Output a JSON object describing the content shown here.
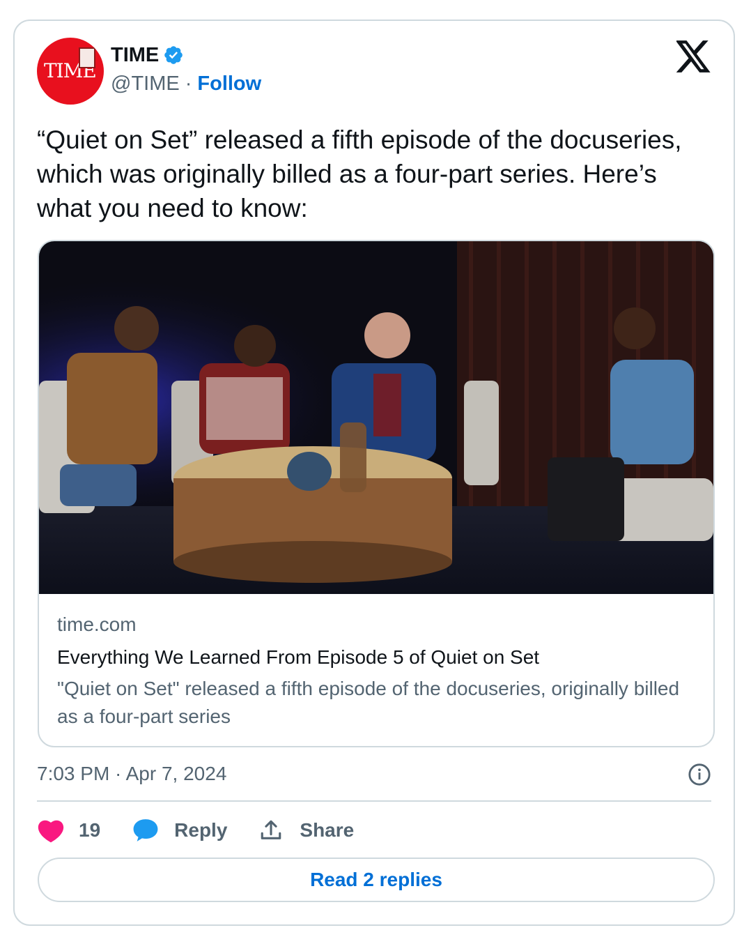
{
  "author": {
    "name": "TIME",
    "handle": "@TIME",
    "separator": "·",
    "follow_label": "Follow",
    "avatar_text": "TIME",
    "verified": true
  },
  "tweet": {
    "text": "“Quiet on Set” released a fifth episode of the docuseries, which was originally billed as a four-part series. Here’s what you need to know:"
  },
  "link_card": {
    "domain": "time.com",
    "title": "Everything We Learned From Episode 5 of Quiet on Set",
    "description": "\"Quiet on Set\" released a fifth episode of the docuseries, originally billed as a four-part series"
  },
  "meta": {
    "timestamp": "7:03 PM · Apr 7, 2024"
  },
  "actions": {
    "like_count": "19",
    "reply_label": "Reply",
    "share_label": "Share"
  },
  "read_replies_label": "Read 2 replies",
  "icons": {
    "platform": "x-logo-icon",
    "verified": "verified-badge-icon",
    "info": "info-icon",
    "like": "heart-icon",
    "reply": "speech-bubble-icon",
    "share": "share-upload-icon"
  },
  "colors": {
    "accent_blue": "#006fd6",
    "verified_blue": "#1d9bf0",
    "heart_pink": "#f91880",
    "reply_blue": "#1d9bf0",
    "muted_text": "#536471",
    "border": "#cfd9de",
    "time_red": "#e8101e"
  }
}
